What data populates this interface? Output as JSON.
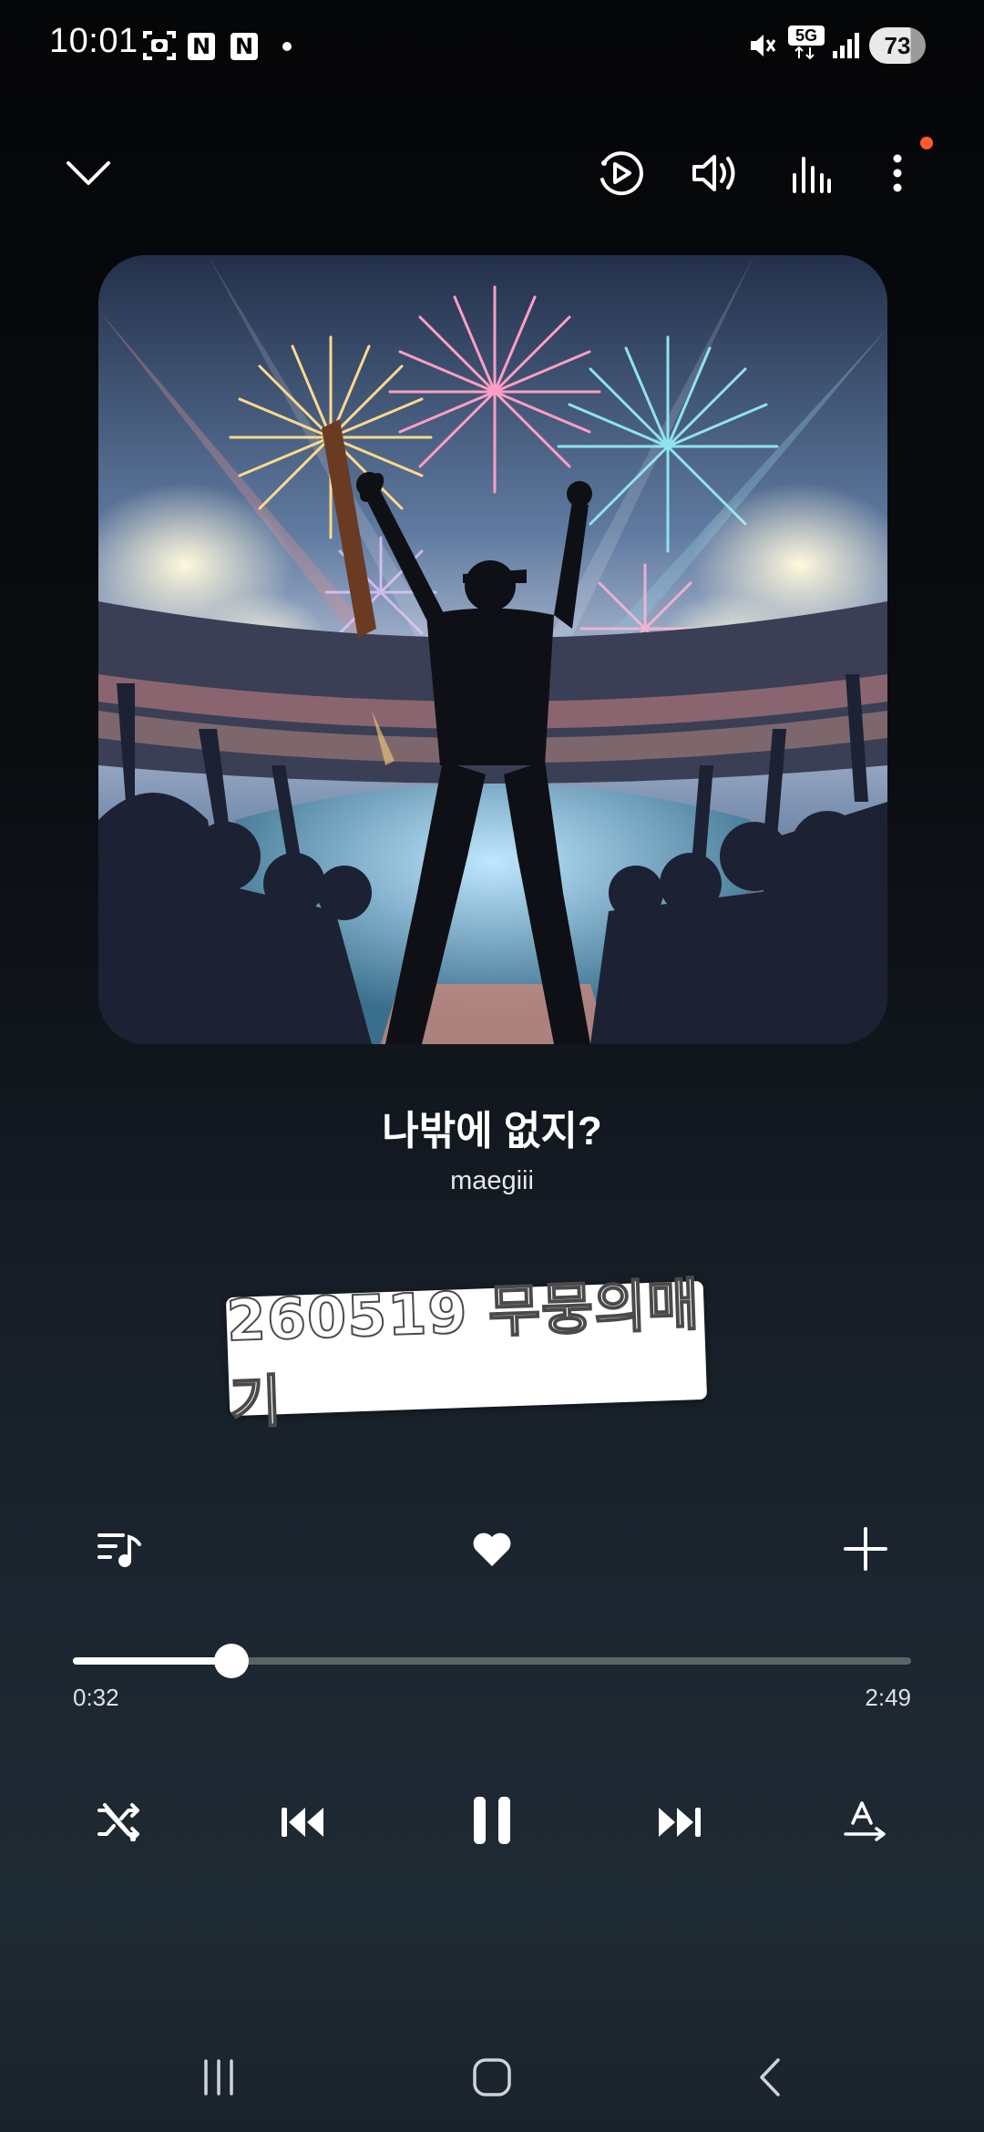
{
  "status_bar": {
    "time": "10:01",
    "badge1": "N",
    "badge2": "N",
    "network": "5G",
    "battery": "73"
  },
  "top_controls": {
    "collapse_icon": "chevron-down-icon",
    "smart_view_icon": "cast-play-icon",
    "volume_icon": "volume-icon",
    "equalizer_icon": "equalizer-icon",
    "more_icon": "more-vertical-icon"
  },
  "album_art": {
    "description_icon": "album-art"
  },
  "track": {
    "title": "나밖에 없지?",
    "artist": "maegiii"
  },
  "lyric_card": {
    "text": "260519 무뭉의매기"
  },
  "actions": {
    "queue_icon": "playlist-icon",
    "favorite_icon": "heart-icon",
    "add_icon": "plus-icon"
  },
  "progress": {
    "elapsed": "0:32",
    "duration": "2:49",
    "fraction": 0.189
  },
  "playback": {
    "shuffle_icon": "shuffle-off-icon",
    "prev_icon": "skip-previous-icon",
    "play_pause_icon": "pause-icon",
    "next_icon": "skip-next-icon",
    "repeat_icon": "repeat-a-icon"
  },
  "nav_bar": {
    "recents_icon": "recents-icon",
    "home_icon": "home-icon",
    "back_icon": "back-icon"
  },
  "colors": {
    "accent_dot": "#ff5a2a",
    "track_bg": "#5d6468",
    "track_fill": "#ffffff"
  }
}
